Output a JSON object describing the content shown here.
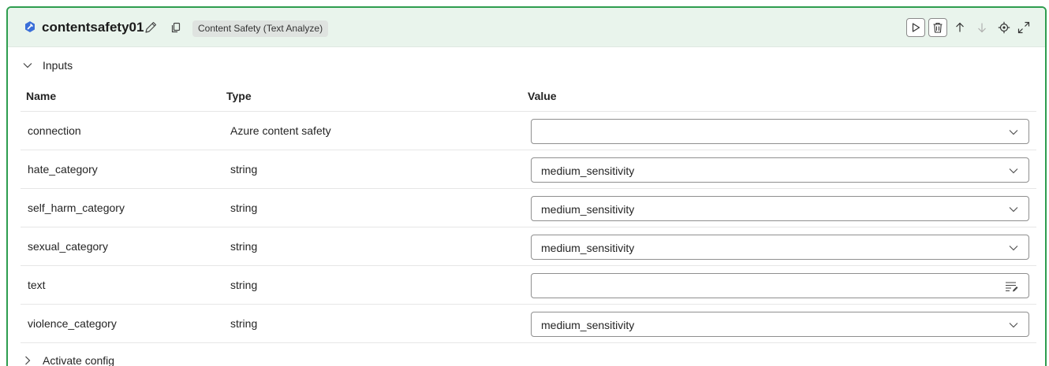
{
  "header": {
    "title": "contentsafety01",
    "type_badge": "Content Safety (Text Analyze)",
    "icons": [
      "tool-icon",
      "edit-pencil-icon",
      "copy-icon",
      "run-icon",
      "delete-icon",
      "move-up-icon",
      "move-down-icon",
      "locate-icon",
      "expand-icon"
    ]
  },
  "inputs_section": {
    "label": "Inputs",
    "expanded": true
  },
  "table": {
    "columns": [
      "Name",
      "Type",
      "Value"
    ],
    "rows": [
      {
        "name": "connection",
        "type": "Azure content safety",
        "value": "",
        "control": "dropdown"
      },
      {
        "name": "hate_category",
        "type": "string",
        "value": "medium_sensitivity",
        "control": "dropdown"
      },
      {
        "name": "self_harm_category",
        "type": "string",
        "value": "medium_sensitivity",
        "control": "dropdown"
      },
      {
        "name": "sexual_category",
        "type": "string",
        "value": "medium_sensitivity",
        "control": "dropdown"
      },
      {
        "name": "text",
        "type": "string",
        "value": "",
        "control": "text-editor"
      },
      {
        "name": "violence_category",
        "type": "string",
        "value": "medium_sensitivity",
        "control": "dropdown"
      }
    ]
  },
  "activate_section": {
    "label": "Activate config",
    "expanded": false
  },
  "colors": {
    "accent_border": "#2e9d4f",
    "header_bg": "#e9f4ec",
    "icon_blue": "#3a6fd8"
  }
}
